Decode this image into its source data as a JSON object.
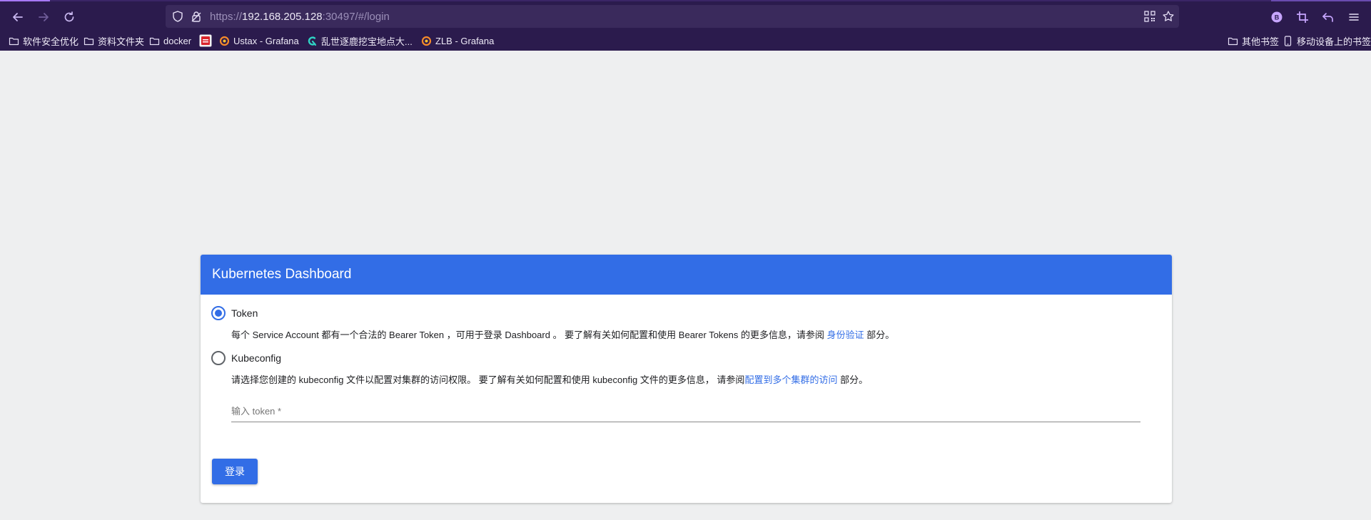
{
  "browser": {
    "url_prefix": "https://",
    "url_host": "192.168.205.128",
    "url_rest": ":30497/#/login",
    "bookmarks": [
      {
        "label": "软件安全优化",
        "icon": "folder-icon"
      },
      {
        "label": "资料文件夹",
        "icon": "folder-icon"
      },
      {
        "label": "docker",
        "icon": "folder-icon"
      },
      {
        "label": "",
        "icon": "red-app-icon"
      },
      {
        "label": "Ustax - Grafana",
        "icon": "grafana-icon"
      },
      {
        "label": "乱世逐鹿挖宝地点大...",
        "icon": "teal-app-icon"
      },
      {
        "label": "ZLB - Grafana",
        "icon": "grafana-icon"
      }
    ],
    "bookmarks_right": [
      {
        "label": "其他书签",
        "icon": "folder-icon"
      },
      {
        "label": "移动设备上的书签",
        "icon": "mobile-icon"
      }
    ],
    "colors": {
      "chrome": "#2b1b4d",
      "urlbar": "#3a2a5c",
      "accent": "#a678f5"
    }
  },
  "card": {
    "title": "Kubernetes Dashboard",
    "header_color": "#326de6",
    "options": [
      {
        "label": "Token",
        "checked": true,
        "desc_before": "每个 Service Account 都有一个合法的 Bearer Token ，可用于登录 Dashboard 。 要了解有关如何配置和使用 Bearer Tokens 的更多信息，请参阅 ",
        "desc_link": "身份验证",
        "desc_after": " 部分。"
      },
      {
        "label": "Kubeconfig",
        "checked": false,
        "desc_before": "请选择您创建的 kubeconfig 文件以配置对集群的访问权限。 要了解有关如何配置和使用 kubeconfig 文件的更多信息， 请参阅",
        "desc_link": "配置到多个集群的访问",
        "desc_after": " 部分。"
      }
    ],
    "token_placeholder": "输入 token *",
    "token_value": "",
    "login_label": "登录"
  }
}
